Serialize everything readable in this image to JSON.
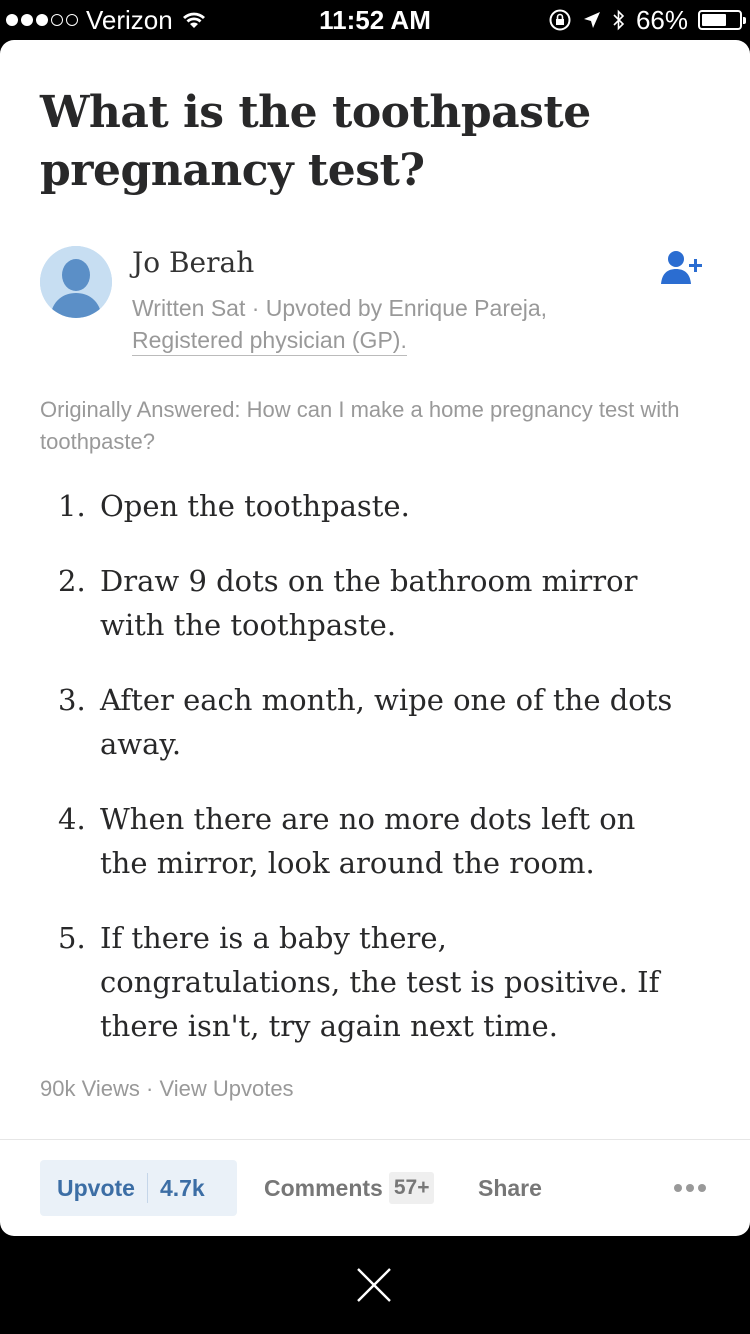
{
  "status_bar": {
    "carrier": "Verizon",
    "time": "11:52 AM",
    "battery": "66%",
    "battery_level": 0.66,
    "signal_bars": 3,
    "icons": [
      "wifi-icon",
      "rotation-lock-icon",
      "location-icon",
      "bluetooth-icon",
      "battery-icon"
    ]
  },
  "question": {
    "title": "What is the toothpaste pregnancy test?"
  },
  "author": {
    "name": "Jo Berah",
    "written": "Written Sat · Upvoted by Enrique Pareja,",
    "credential": "Registered physician (GP).",
    "follow_icon": "add-user-icon"
  },
  "answer": {
    "originally_answered": "Originally Answered: How can I make a home pregnancy test with toothpaste?",
    "steps": [
      {
        "num": "1.",
        "text": "Open the toothpaste."
      },
      {
        "num": "2.",
        "text": "Draw 9 dots on the bathroom mirror with the toothpaste."
      },
      {
        "num": "3.",
        "text": "After each month, wipe one of the dots away."
      },
      {
        "num": "4.",
        "text": "When there are no more dots left on the mirror, look around the room."
      },
      {
        "num": "5.",
        "text": "If there is a baby there, congratulations, the test is positive. If there isn't, try again next time."
      }
    ],
    "views": "90k Views",
    "separator": "·",
    "view_upvotes": "View Upvotes"
  },
  "actions": {
    "upvote_label": "Upvote",
    "upvote_count": "4.7k",
    "comments_label": "Comments",
    "comments_count": "57+",
    "share_label": "Share",
    "more_icon": "more-dots-icon"
  },
  "colors": {
    "accent": "#3c6ea5",
    "upvote_bg": "#eaf1f8",
    "follow_icon": "#2b6dd1",
    "muted_text": "#999999",
    "title_text": "#282829"
  }
}
